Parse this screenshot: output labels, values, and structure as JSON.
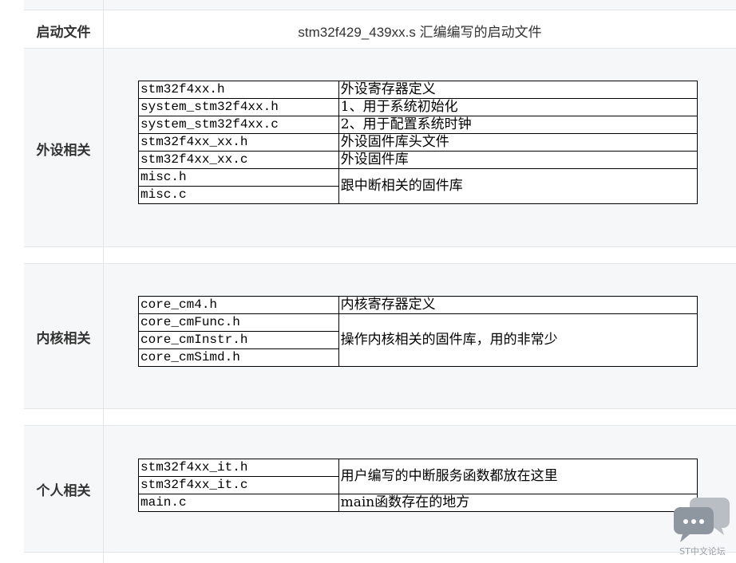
{
  "rows": {
    "startup": {
      "label": "启动文件",
      "content": "stm32f429_439xx.s 汇编编写的启动文件"
    },
    "peripheral": {
      "label": "外设相关",
      "files": [
        "stm32f4xx.h",
        "system_stm32f4xx.h",
        "system_stm32f4xx.c",
        "stm32f4xx_xx.h",
        "stm32f4xx_xx.c",
        "misc.h",
        "misc.c"
      ],
      "descs": [
        "外设寄存器定义",
        "1、用于系统初始化",
        "2、用于配置系统时钟",
        "外设固件库头文件",
        "外设固件库",
        "跟中断相关的固件库"
      ]
    },
    "kernel": {
      "label": "内核相关",
      "files": [
        "core_cm4.h",
        "core_cmFunc.h",
        "core_cmInstr.h",
        "core_cmSimd.h"
      ],
      "descs": [
        "内核寄存器定义",
        "操作内核相关的固件库，用的非常少"
      ]
    },
    "personal": {
      "label": "个人相关",
      "files": [
        "stm32f4xx_it.h",
        "stm32f4xx_it.c",
        "main.c"
      ],
      "descs": [
        "用户编写的中断服务函数都放在这里",
        "main函数存在的地方"
      ]
    }
  },
  "watermark": {
    "text": "ST中文论坛",
    "icon": "chat-bubbles-icon",
    "color": "#9aa0a8"
  },
  "colors": {
    "row_bg_gray": "#f6f7f8",
    "border": "#e5e6e7",
    "text": "#333333"
  }
}
